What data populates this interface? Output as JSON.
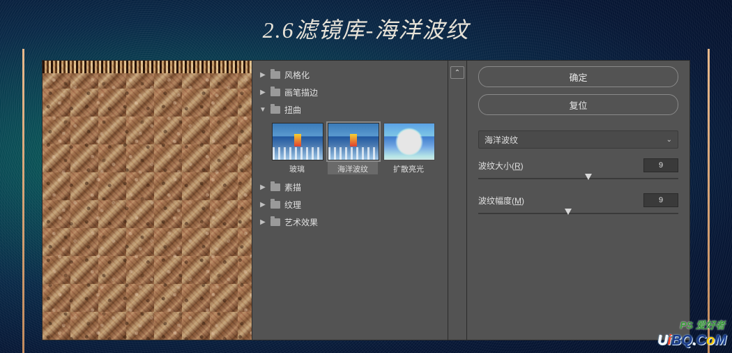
{
  "title": "2.6滤镜库-海洋波纹",
  "tree": {
    "stylize": "风格化",
    "brush": "画笔描边",
    "distort": "扭曲",
    "sketch": "素描",
    "texture": "纹理",
    "artistic": "艺术效果"
  },
  "thumbs": {
    "glass": "玻璃",
    "ocean": "海洋波纹",
    "diffuse": "扩散亮光"
  },
  "buttons": {
    "ok": "确定",
    "reset": "复位"
  },
  "dropdown": {
    "selected": "海洋波纹"
  },
  "params": {
    "size_label": "波纹大小(",
    "size_key": "R",
    "size_suffix": ")",
    "size_value": "9",
    "size_pos": "55%",
    "mag_label": "波纹幅度(",
    "mag_key": "M",
    "mag_suffix": ")",
    "mag_value": "9",
    "mag_pos": "45%"
  },
  "watermark": {
    "small": "PS 爱好者",
    "u": "U",
    "i": "i",
    "b": "BQ",
    "dot": ".",
    "c": "C",
    "o": "o",
    "m": "M"
  }
}
